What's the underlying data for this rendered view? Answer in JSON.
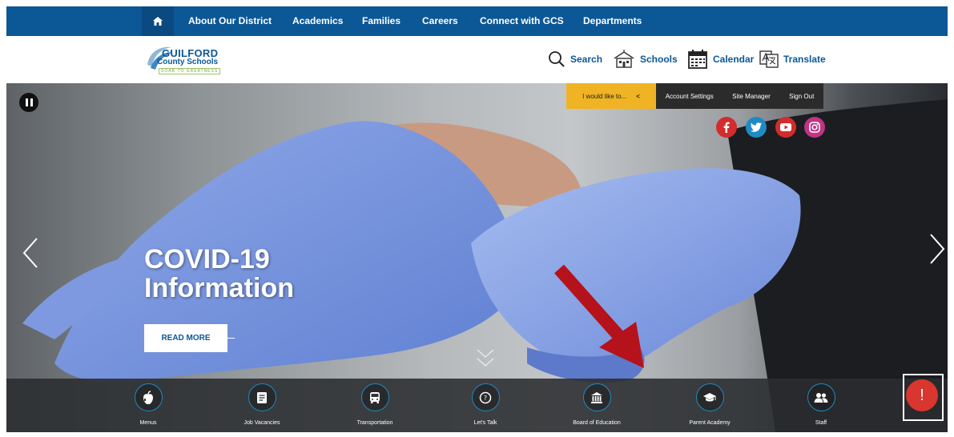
{
  "nav": {
    "home_icon": "home-icon",
    "items": [
      "About Our District",
      "Academics",
      "Families",
      "Careers",
      "Connect with GCS",
      "Departments"
    ]
  },
  "logo": {
    "line1": "GUILFORD",
    "line2": "County Schools",
    "tagline": "SOAR TO GREATNESS"
  },
  "utility": {
    "search": "Search",
    "schools": "Schools",
    "calendar": "Calendar",
    "translate": "Translate"
  },
  "hero": {
    "i_would_like": "I would like to...",
    "i_would_like_chevron": "<",
    "account_settings": "Account Settings",
    "site_manager": "Site Manager",
    "sign_out": "Sign Out",
    "social": [
      "facebook-icon",
      "twitter-icon",
      "youtube-icon",
      "instagram-icon"
    ],
    "title_line1": "COVID-19",
    "title_line2": "Information",
    "read_more": "READ MORE"
  },
  "quick_links": [
    "Menus",
    "Job Vacancies",
    "Transportation",
    "Let's Talk",
    "Board of Education",
    "Parent Academy",
    "Staff"
  ],
  "alert": {
    "symbol": "!"
  },
  "colors": {
    "nav_blue": "#0c5796",
    "accent_yellow": "#f0b323",
    "alert_red": "#d8362f",
    "annotation_arrow": "#b5121b"
  }
}
